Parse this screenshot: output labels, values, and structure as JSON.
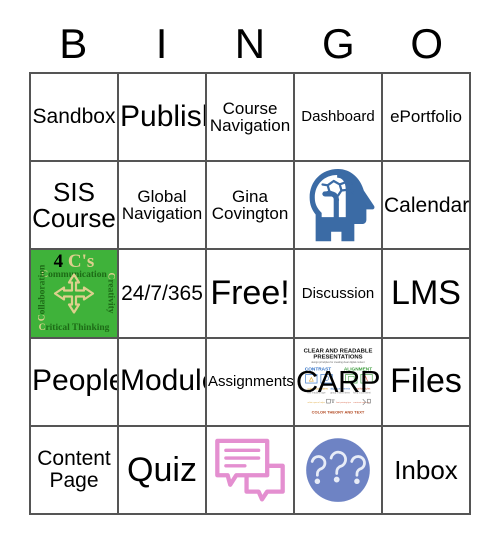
{
  "card": {
    "header_letters": [
      "B",
      "I",
      "N",
      "G",
      "O"
    ],
    "rows": [
      [
        {
          "type": "text",
          "text": "Sandbox",
          "size": "md"
        },
        {
          "type": "text",
          "text": "Publish",
          "size": "xl"
        },
        {
          "type": "text",
          "text": "Course\nNavigation",
          "size": "sm"
        },
        {
          "type": "text",
          "text": "Dashboard",
          "size": "xs"
        },
        {
          "type": "text",
          "text": "ePortfolio",
          "size": "sm"
        }
      ],
      [
        {
          "type": "text",
          "text": "SIS\nCourse",
          "size": "lg"
        },
        {
          "type": "text",
          "text": "Global\nNavigation",
          "size": "sm"
        },
        {
          "type": "text",
          "text": "Gina\nCovington",
          "size": "sm"
        },
        {
          "type": "image",
          "image": "brain-head-icon",
          "alt": "Blue head silhouette with white brain"
        },
        {
          "type": "text",
          "text": "Calendar",
          "size": "md"
        }
      ],
      [
        {
          "type": "image",
          "image": "four-cs-graphic",
          "alt": "4 C's green graphic"
        },
        {
          "type": "text",
          "text": "24/7/365",
          "size": "md"
        },
        {
          "type": "text",
          "text": "Free!",
          "size": "xxl"
        },
        {
          "type": "text",
          "text": "Discussion",
          "size": "xs"
        },
        {
          "type": "text",
          "text": "LMS",
          "size": "xxl"
        }
      ],
      [
        {
          "type": "text",
          "text": "People",
          "size": "xl"
        },
        {
          "type": "text",
          "text": "Module",
          "size": "xl"
        },
        {
          "type": "text",
          "text": "Assignments",
          "size": "xs"
        },
        {
          "type": "image",
          "image": "carp-infographic",
          "overlay": "CARP",
          "alt": "Clear and readable presentations infographic"
        },
        {
          "type": "text",
          "text": "Files",
          "size": "xxl"
        }
      ],
      [
        {
          "type": "text",
          "text": "Content\nPage",
          "size": "md"
        },
        {
          "type": "text",
          "text": "Quiz",
          "size": "xxl"
        },
        {
          "type": "image",
          "image": "chat-bubbles-icon",
          "alt": "Pink speech bubbles"
        },
        {
          "type": "image",
          "image": "question-marks-icon",
          "alt": "Blue circle with question marks"
        },
        {
          "type": "text",
          "text": "Inbox",
          "size": "lg"
        }
      ]
    ]
  },
  "graphics": {
    "four_cs": {
      "title_number": "4",
      "title_word": "C's",
      "top_initial": "C",
      "top_rest": "ommunication",
      "right_initial": "C",
      "right_rest": "reativity",
      "bottom_initial": "C",
      "bottom_rest": "ritical Thinking",
      "left_initial": "C",
      "left_rest": "ollaboration",
      "background_color": "#3fb23a",
      "accent_color": "#ddd08d"
    },
    "carp": {
      "heading": "CLEAR AND READABLE PRESENTATIONS",
      "subheading": "Design to consider when creating and managing digital content",
      "label_contrast": "CONTRAST",
      "label_alignment": "ALIGNMENT",
      "label_repetition": "REPETITION",
      "label_proximity": "PROXIMITY",
      "footer": "COLOR THEORY AND TEXT",
      "overlay_text": "CARP",
      "color_contrast": "#2f6fc4",
      "color_alignment": "#3f9d3f",
      "color_repetition": "#d99a1e",
      "color_proximity": "#cf4b2a"
    },
    "brain_head": {
      "color": "#3b6ba5"
    },
    "chat_bubbles": {
      "color": "#e48fd0"
    },
    "question_marks": {
      "circle_color": "#6e83c4",
      "mark_color": "#e7ecf7",
      "text": "???"
    }
  }
}
